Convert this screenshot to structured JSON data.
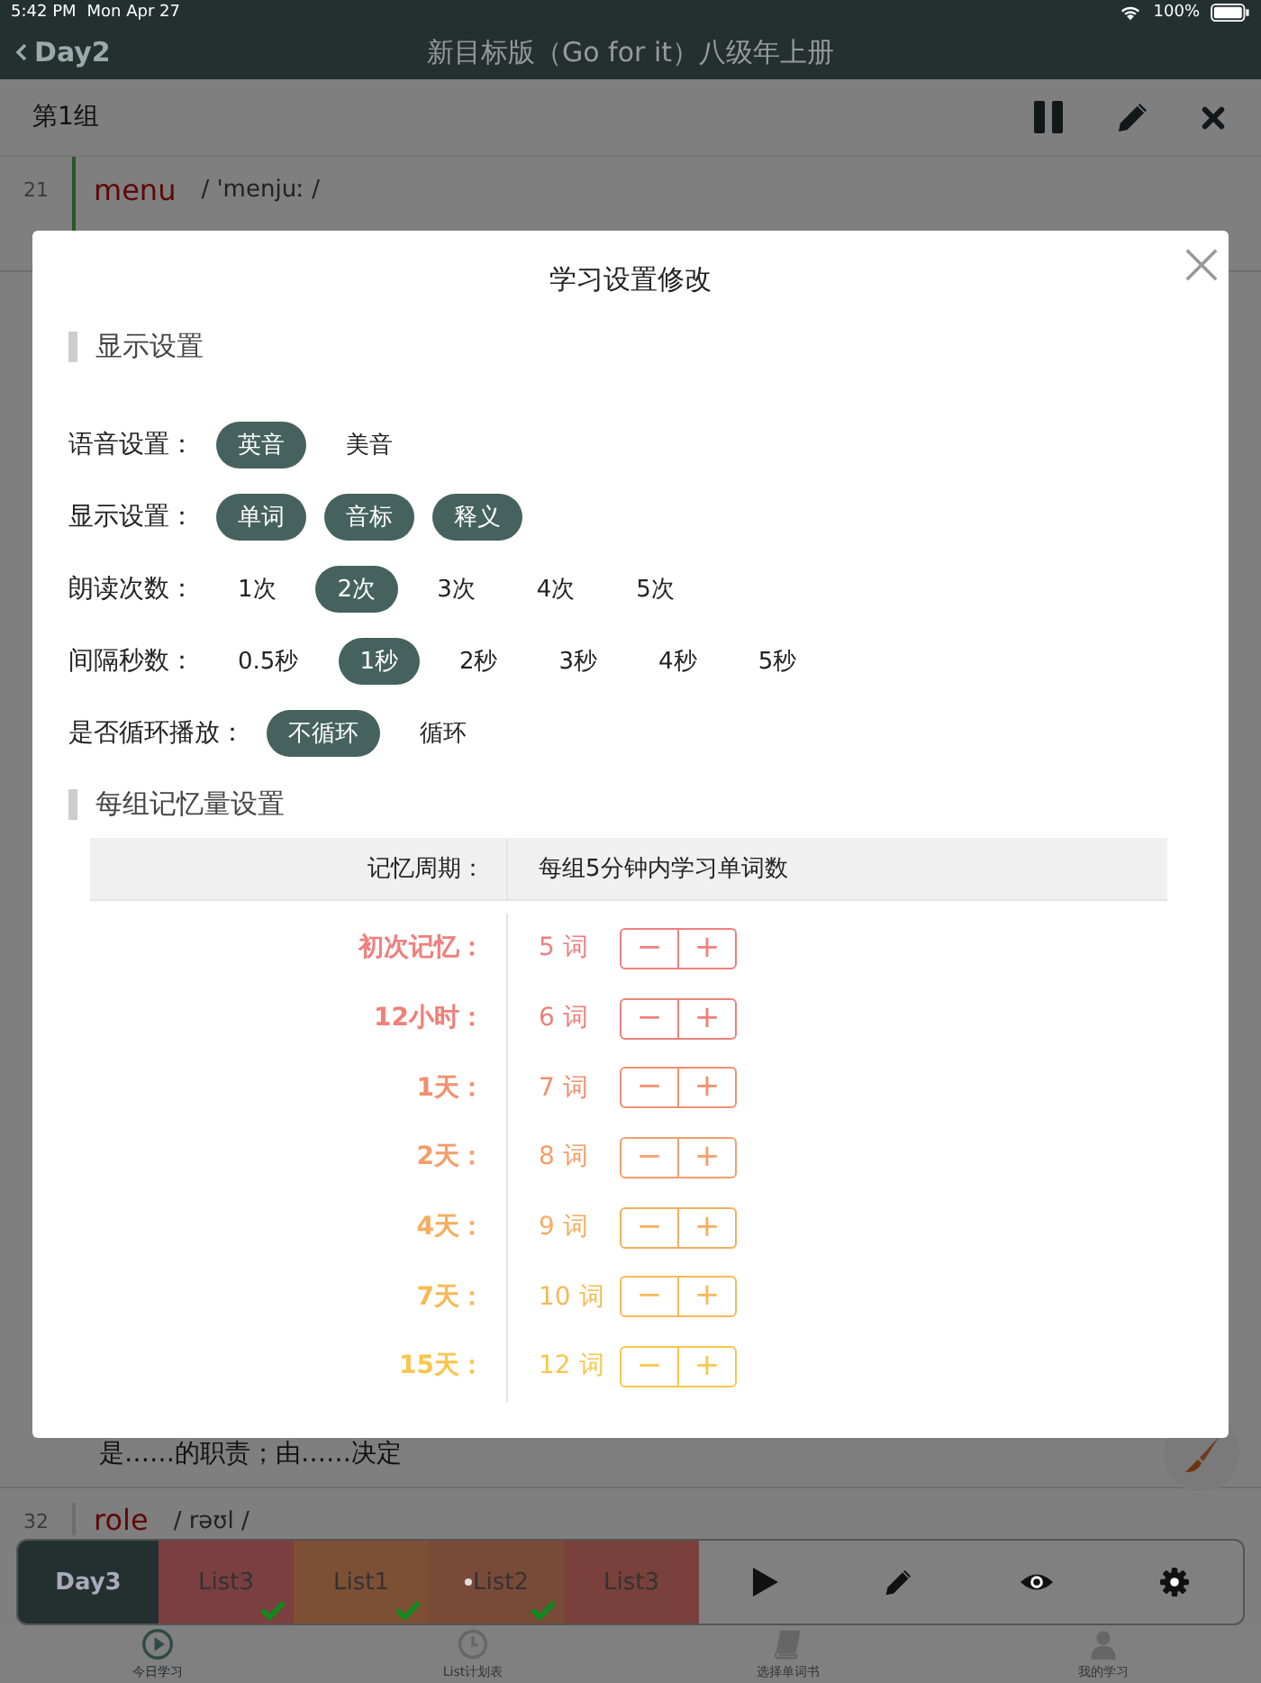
{
  "status_bar": {
    "time": "5:42 PM",
    "date": "Mon Apr 27",
    "battery": "100%"
  },
  "nav": {
    "back": "Day2",
    "title": "新目标版（Go for it）八级年上册"
  },
  "group_bar": {
    "title": "第1组"
  },
  "words_top": [
    {
      "number": "21",
      "word": "menu",
      "phonetic": "/ 'menjuː /"
    }
  ],
  "definition": "是……的职责；由……决定",
  "words_bottom": [
    {
      "number": "32",
      "word": "role",
      "phonetic": "/ rəʊl /"
    }
  ],
  "player": {
    "day": "Day3",
    "lists": [
      {
        "label": "List3",
        "color": "#7b3f3f",
        "checked": true,
        "marked": false
      },
      {
        "label": "List1",
        "color": "#7d5035",
        "checked": true,
        "marked": false
      },
      {
        "label": "List2",
        "color": "#7a4a38",
        "checked": true,
        "marked": true
      },
      {
        "label": "List3",
        "color": "#7a403b",
        "checked": false,
        "marked": false
      }
    ]
  },
  "tab_bar": [
    {
      "label": "今日学习",
      "kind": "play",
      "selected": true
    },
    {
      "label": "List计划表",
      "kind": "clock",
      "selected": false
    },
    {
      "label": "选择单词书",
      "kind": "book",
      "selected": false
    },
    {
      "label": "我的学习",
      "kind": "person",
      "selected": false
    }
  ],
  "dialog": {
    "title": "学习设置修改",
    "display_section": "显示设置",
    "settings": [
      {
        "label": "语音设置：",
        "options": [
          {
            "label": "英音",
            "selected": true
          },
          {
            "label": "美音",
            "selected": false
          }
        ]
      },
      {
        "label": "显示设置：",
        "options": [
          {
            "label": "单词",
            "selected": true
          },
          {
            "label": "音标",
            "selected": true
          },
          {
            "label": "释义",
            "selected": true
          }
        ]
      },
      {
        "label": "朗读次数：",
        "options": [
          {
            "label": "1次",
            "selected": false
          },
          {
            "label": "2次",
            "selected": true
          },
          {
            "label": "3次",
            "selected": false
          },
          {
            "label": "4次",
            "selected": false
          },
          {
            "label": "5次",
            "selected": false
          }
        ]
      },
      {
        "label": "间隔秒数：",
        "options": [
          {
            "label": "0.5秒",
            "selected": false
          },
          {
            "label": "1秒",
            "selected": true
          },
          {
            "label": "2秒",
            "selected": false
          },
          {
            "label": "3秒",
            "selected": false
          },
          {
            "label": "4秒",
            "selected": false
          },
          {
            "label": "5秒",
            "selected": false
          }
        ]
      },
      {
        "label": "是否循环播放：",
        "options": [
          {
            "label": "不循环",
            "selected": true
          },
          {
            "label": "循环",
            "selected": false
          }
        ]
      }
    ],
    "memory_section": "每组记忆量设置",
    "table": {
      "columns": [
        "记忆周期：",
        "每组5分钟内学习单词数"
      ],
      "rows": [
        {
          "period": "初次记忆：",
          "count": "5 词",
          "color": "#f07f7f",
          "minus": "−",
          "plus": "+"
        },
        {
          "period": "12小时：",
          "count": "6 词",
          "color": "#f08078",
          "minus": "−",
          "plus": "+"
        },
        {
          "period": "1天：",
          "count": "7 词",
          "color": "#f2906e",
          "minus": "−",
          "plus": "+"
        },
        {
          "period": "2天：",
          "count": "8 词",
          "color": "#f49e6a",
          "minus": "−",
          "plus": "+"
        },
        {
          "period": "4天：",
          "count": "9 词",
          "color": "#f6ad5f",
          "minus": "−",
          "plus": "+"
        },
        {
          "period": "7天：",
          "count": "10 词",
          "color": "#f8b955",
          "minus": "−",
          "plus": "+"
        },
        {
          "period": "15天：",
          "count": "12 词",
          "color": "#f9c64c",
          "minus": "−",
          "plus": "+"
        }
      ]
    }
  }
}
